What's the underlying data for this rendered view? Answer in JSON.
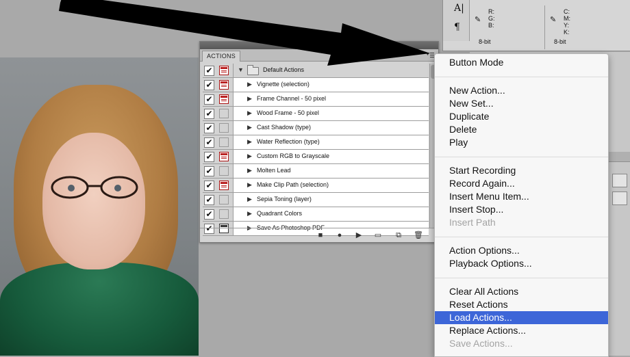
{
  "info_panel": {
    "tool_glyphs": [
      "A|",
      "¶"
    ],
    "rgb": {
      "channels": [
        "R:",
        "G:",
        "B:"
      ],
      "depth": "8-bit"
    },
    "cmyk": {
      "channels": [
        "C:",
        "M:",
        "Y:",
        "K:"
      ],
      "depth": "8-bit"
    }
  },
  "actions_panel": {
    "tab_label": "ACTIONS",
    "set_name": "Default Actions",
    "actions": [
      {
        "label": "Vignette (selection)",
        "dialog": "on"
      },
      {
        "label": "Frame Channel - 50 pixel",
        "dialog": "on"
      },
      {
        "label": "Wood Frame - 50 pixel",
        "dialog": "off"
      },
      {
        "label": "Cast Shadow (type)",
        "dialog": "off"
      },
      {
        "label": "Water Reflection (type)",
        "dialog": "off"
      },
      {
        "label": "Custom RGB to Grayscale",
        "dialog": "on"
      },
      {
        "label": "Molten Lead",
        "dialog": "off"
      },
      {
        "label": "Make Clip Path (selection)",
        "dialog": "on"
      },
      {
        "label": "Sepia Toning (layer)",
        "dialog": "off"
      },
      {
        "label": "Quadrant Colors",
        "dialog": "off"
      },
      {
        "label": "Save As Photoshop PDF",
        "dialog": "dark"
      }
    ],
    "toolbar_icons": [
      "stop-icon",
      "record-icon",
      "play-icon",
      "new-set-icon",
      "new-action-icon",
      "trash-icon"
    ]
  },
  "menu": {
    "groups": [
      [
        {
          "label": "Button Mode",
          "enabled": true
        }
      ],
      [
        {
          "label": "New Action...",
          "enabled": true
        },
        {
          "label": "New Set...",
          "enabled": true
        },
        {
          "label": "Duplicate",
          "enabled": true
        },
        {
          "label": "Delete",
          "enabled": true
        },
        {
          "label": "Play",
          "enabled": true
        }
      ],
      [
        {
          "label": "Start Recording",
          "enabled": true
        },
        {
          "label": "Record Again...",
          "enabled": true
        },
        {
          "label": "Insert Menu Item...",
          "enabled": true
        },
        {
          "label": "Insert Stop...",
          "enabled": true
        },
        {
          "label": "Insert Path",
          "enabled": false
        }
      ],
      [
        {
          "label": "Action Options...",
          "enabled": true
        },
        {
          "label": "Playback Options...",
          "enabled": true
        }
      ],
      [
        {
          "label": "Clear All Actions",
          "enabled": true
        },
        {
          "label": "Reset Actions",
          "enabled": true
        },
        {
          "label": "Load Actions...",
          "enabled": true,
          "highlighted": true
        },
        {
          "label": "Replace Actions...",
          "enabled": true
        },
        {
          "label": "Save Actions...",
          "enabled": false
        }
      ]
    ]
  },
  "colors": {
    "menu_highlight": "#3d66d8",
    "dialog_red": "#b22222"
  }
}
